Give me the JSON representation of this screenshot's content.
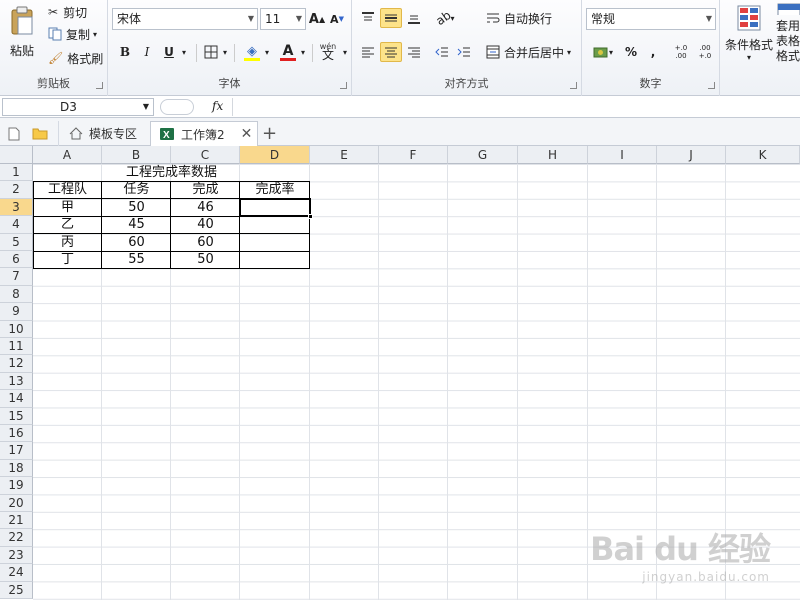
{
  "ribbon": {
    "clipboard": {
      "paste": "粘贴",
      "cut": "剪切",
      "copy": "复制",
      "format_painter": "格式刷",
      "label": "剪贴板"
    },
    "font": {
      "name": "宋体",
      "size": "11",
      "bold": "B",
      "italic": "I",
      "underline": "U",
      "grow": "A",
      "shrink": "A",
      "font_color_letter": "A",
      "pinyin": "wén",
      "label": "字体"
    },
    "alignment": {
      "wrap": "自动换行",
      "merge": "合并后居中",
      "label": "对齐方式"
    },
    "number": {
      "format": "常规",
      "percent": "%",
      "comma": ",",
      "inc_decimal": "+.0 .00",
      "dec_decimal": ".00 +.0",
      "label": "数字"
    },
    "styles": {
      "conditional": "条件格式",
      "table_format": "套用\n表格格式"
    }
  },
  "colors": {
    "accent_yellow": "#fde38a",
    "header_select": "#f9d88d",
    "font_red": "#e02020",
    "fill_yellow": "#ffff00",
    "excel_green": "#1e7145"
  },
  "formula_bar": {
    "name_box": "D3",
    "fx": "fx",
    "formula": ""
  },
  "tabs": [
    {
      "label": "模板专区",
      "icon": "home-icon"
    },
    {
      "label": "工作簿2",
      "icon": "excel-icon"
    }
  ],
  "columns": [
    "A",
    "B",
    "C",
    "D",
    "E",
    "F",
    "G",
    "H",
    "I",
    "J",
    "K"
  ],
  "rows": [
    "1",
    "2",
    "3",
    "4",
    "5",
    "6",
    "7",
    "8",
    "9",
    "10",
    "11",
    "12",
    "13",
    "14",
    "15",
    "16",
    "17",
    "18",
    "19",
    "20",
    "21",
    "22",
    "23",
    "24",
    "25"
  ],
  "sheet": {
    "title": "工程完成率数据",
    "headers": [
      "工程队",
      "任务",
      "完成",
      "完成率"
    ],
    "data": [
      [
        "甲",
        "50",
        "46",
        ""
      ],
      [
        "乙",
        "45",
        "40",
        ""
      ],
      [
        "丙",
        "60",
        "60",
        ""
      ],
      [
        "丁",
        "55",
        "50",
        ""
      ]
    ]
  },
  "watermark": {
    "logo": "Bai du 经验",
    "site": "jingyan.baidu.com"
  }
}
